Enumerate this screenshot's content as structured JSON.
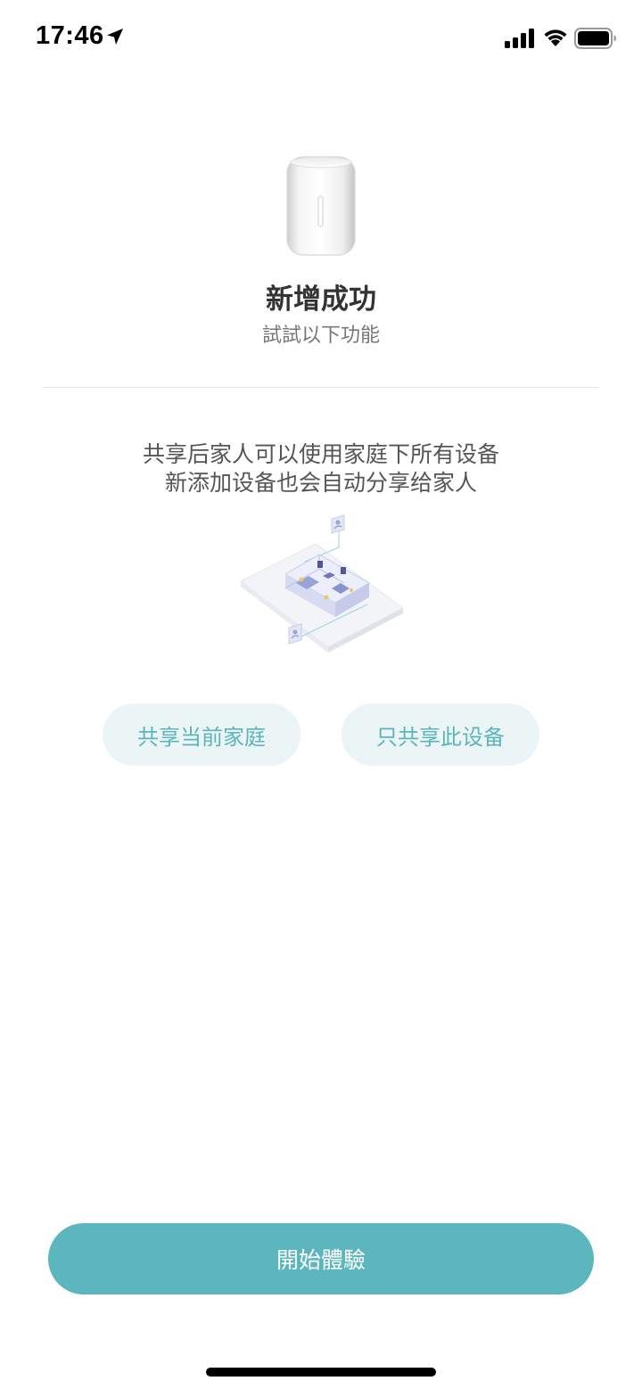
{
  "status_bar": {
    "time": "17:46",
    "icons": [
      "location-arrow-icon",
      "cellular-signal-icon",
      "wifi-icon",
      "battery-icon"
    ]
  },
  "device": {
    "image": "bedside-lamp-icon"
  },
  "header": {
    "title": "新增成功",
    "subtitle": "試試以下功能"
  },
  "share": {
    "description_line1": "共享后家人可以使用家庭下所有设备",
    "description_line2": "新添加设备也会自动分享给家人",
    "illustration": "smart-home-share-illustration",
    "buttons": {
      "share_family": "共享当前家庭",
      "share_device": "只共享此设备"
    }
  },
  "footer": {
    "start_label": "開始體驗"
  },
  "colors": {
    "accent": "#5db6bd",
    "button_soft_bg": "#ebf5f5",
    "button_soft_text": "#5cb5bb"
  }
}
